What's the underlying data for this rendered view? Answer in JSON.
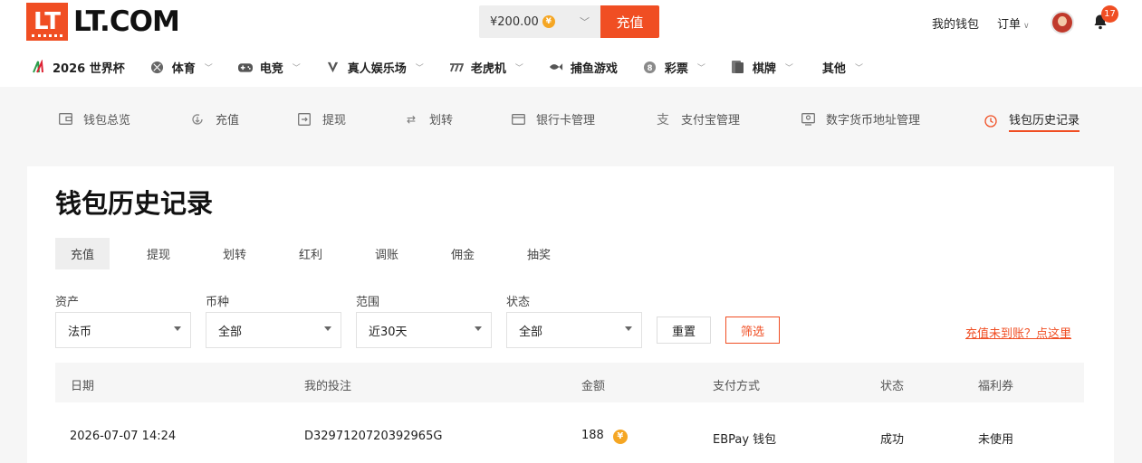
{
  "header": {
    "logo_mark": "LT",
    "logo_text": "LT.COM",
    "balance": "¥200.00",
    "recharge_button": "充值",
    "wallet_link": "我的钱包",
    "orders_link": "订单",
    "notification_count": "17"
  },
  "nav": {
    "items": [
      {
        "label": "2026 世界杯",
        "icon": "worldcup-icon",
        "has_dropdown": false
      },
      {
        "label": "体育",
        "icon": "sports-ball-icon",
        "has_dropdown": true
      },
      {
        "label": "电竞",
        "icon": "gamepad-icon",
        "has_dropdown": true
      },
      {
        "label": "真人娱乐场",
        "icon": "casino-icon",
        "has_dropdown": true
      },
      {
        "label": "老虎机",
        "icon": "slot-icon",
        "has_dropdown": true
      },
      {
        "label": "捕鱼游戏",
        "icon": "fish-icon",
        "has_dropdown": false
      },
      {
        "label": "彩票",
        "icon": "lottery-icon",
        "has_dropdown": true
      },
      {
        "label": "棋牌",
        "icon": "cards-icon",
        "has_dropdown": true
      },
      {
        "label": "其他",
        "icon": "",
        "has_dropdown": true
      }
    ]
  },
  "subnav": {
    "items": [
      {
        "label": "钱包总览",
        "icon": "wallet-icon"
      },
      {
        "label": "充值",
        "icon": "deposit-icon"
      },
      {
        "label": "提现",
        "icon": "withdraw-icon"
      },
      {
        "label": "划转",
        "icon": "transfer-icon"
      },
      {
        "label": "银行卡管理",
        "icon": "bank-card-icon"
      },
      {
        "label": "支付宝管理",
        "icon": "alipay-icon"
      },
      {
        "label": "数字货币地址管理",
        "icon": "crypto-address-icon"
      },
      {
        "label": "钱包历史记录",
        "icon": "clock-icon",
        "active": true
      }
    ]
  },
  "main": {
    "title": "钱包历史记录",
    "tabs": [
      "充值",
      "提现",
      "划转",
      "红利",
      "调账",
      "佣金",
      "抽奖"
    ],
    "active_tab": "充值",
    "filters": {
      "asset": {
        "label": "资产",
        "value": "法币"
      },
      "currency": {
        "label": "币种",
        "value": "全部"
      },
      "range": {
        "label": "范围",
        "value": "近30天"
      },
      "status": {
        "label": "状态",
        "value": "全部"
      }
    },
    "reset_button": "重置",
    "filter_button": "筛选",
    "help_link": "充值未到账？点这里",
    "table": {
      "headers": [
        "日期",
        "我的投注",
        "金额",
        "支付方式",
        "状态",
        "福利券"
      ],
      "rows": [
        [
          "2026-07-07 14:24",
          "D3297120720392965G",
          "188",
          "EBPay 钱包",
          "成功",
          "未使用"
        ]
      ]
    }
  },
  "colors": {
    "accent": "#f04e23",
    "coin": "#f5a623"
  }
}
